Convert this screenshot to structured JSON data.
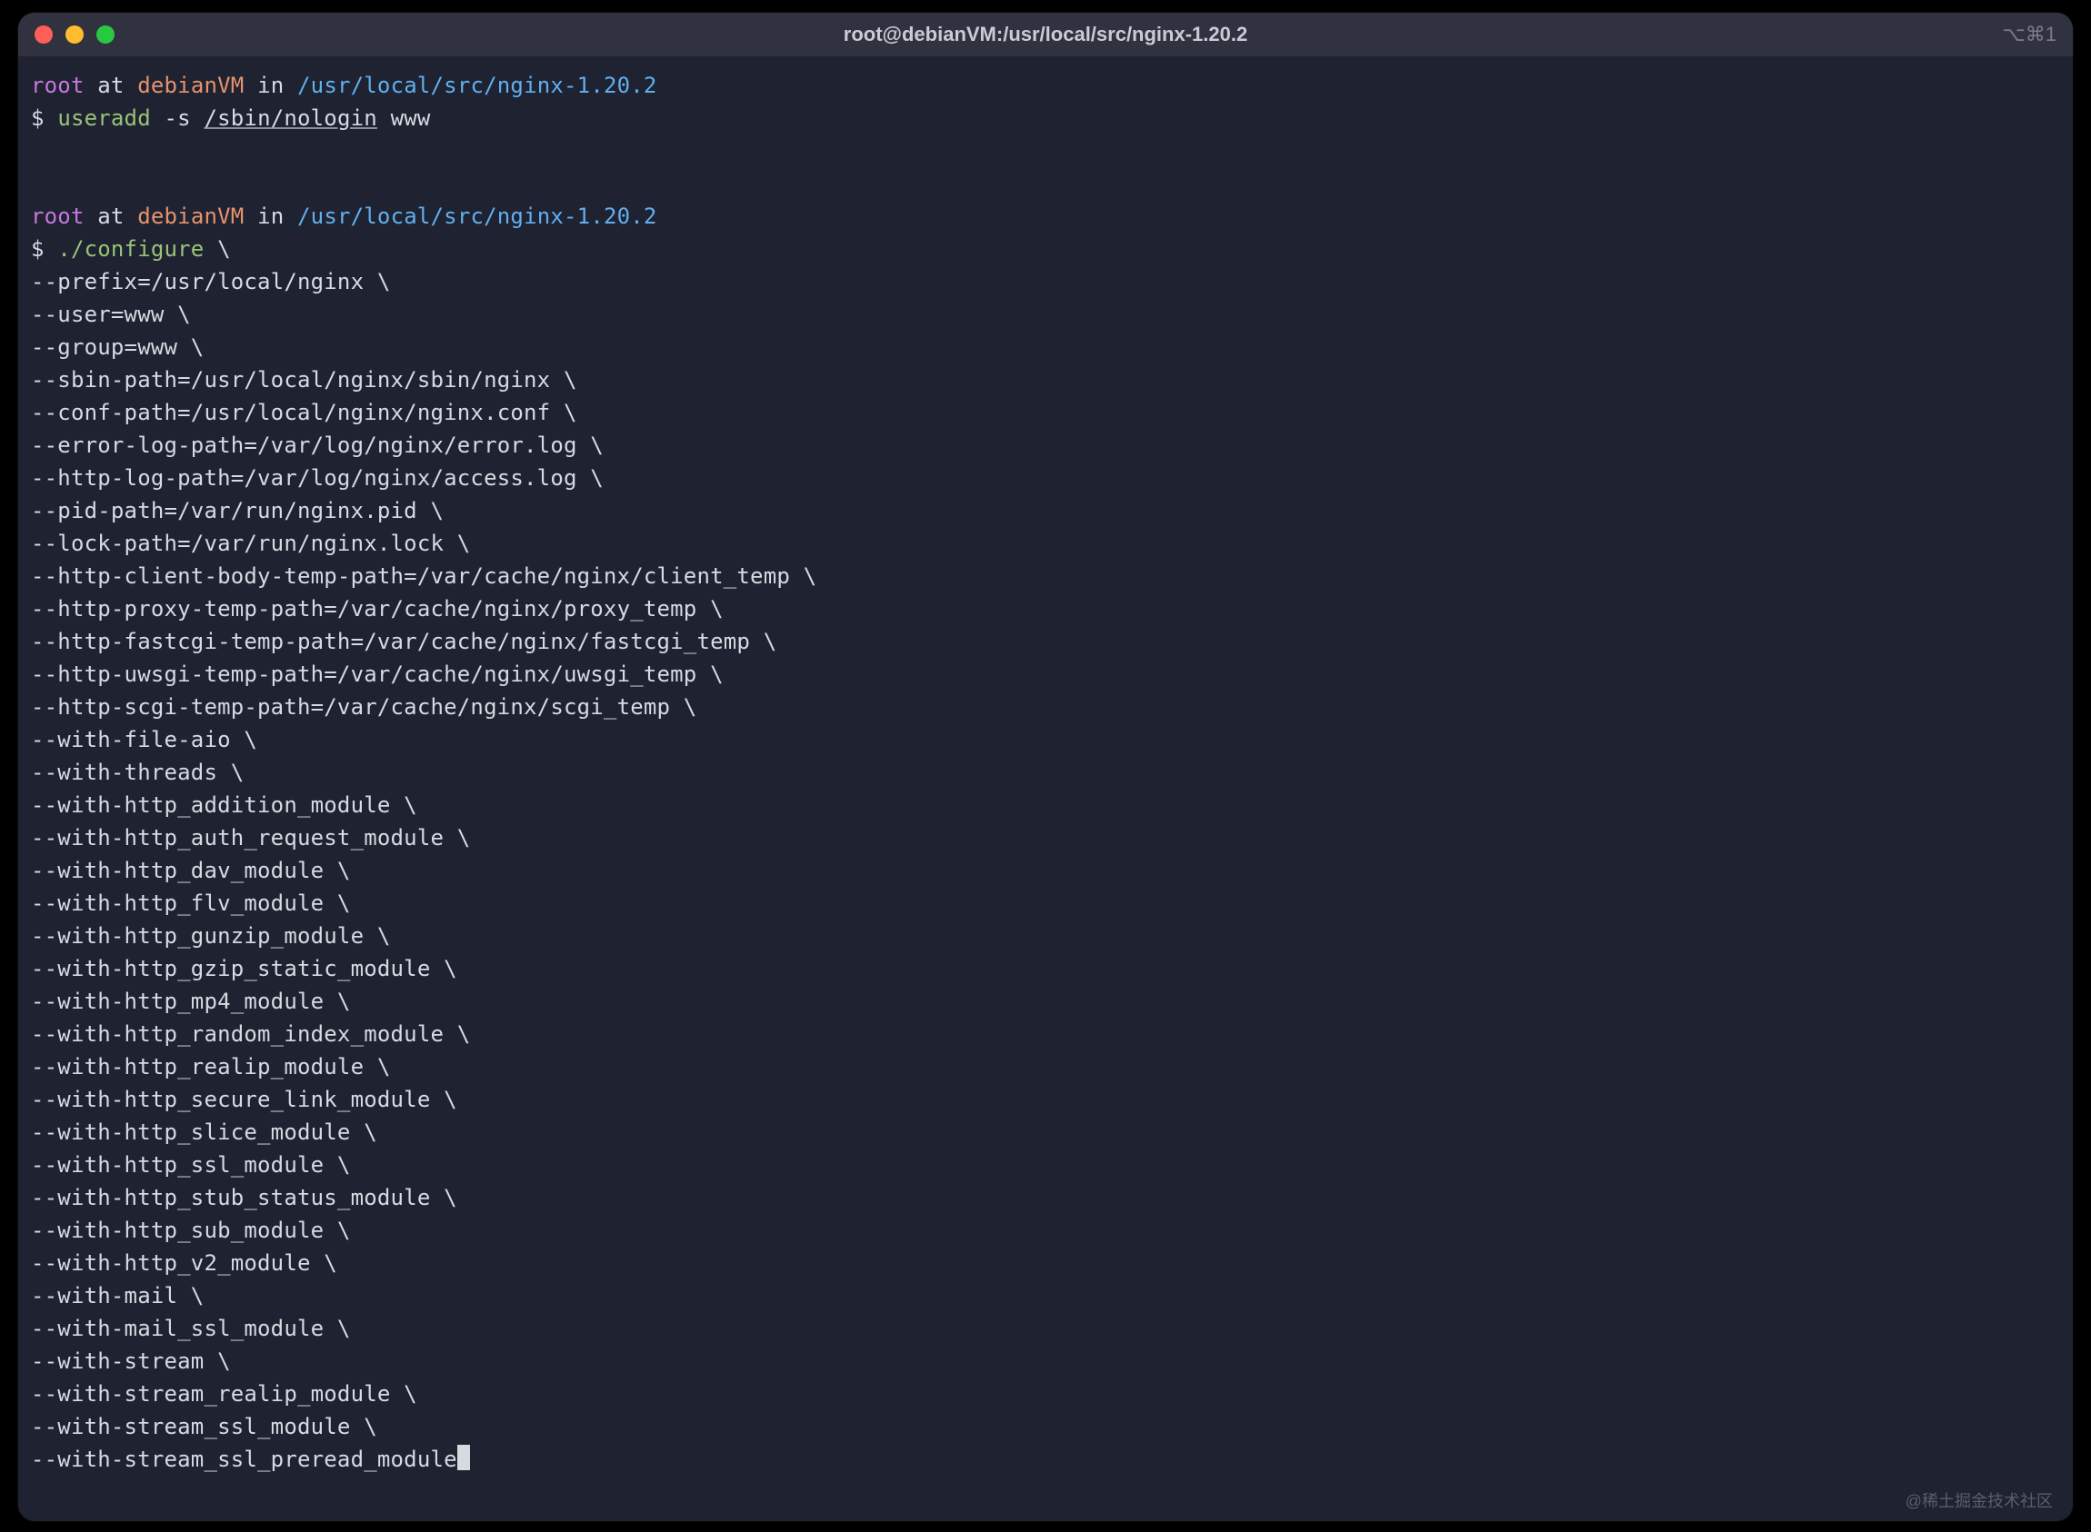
{
  "window": {
    "title": "root@debianVM:/usr/local/src/nginx-1.20.2",
    "shortcut_hint": "⌥⌘1"
  },
  "prompt1": {
    "user": "root",
    "at": " at ",
    "host": "debianVM",
    "in": " in ",
    "path": "/usr/local/src/nginx-1.20.2",
    "dollar": "$ ",
    "cmd": "useradd",
    "flag": " -s ",
    "arg_ul": "/sbin/nologin",
    "arg_rest": " www"
  },
  "prompt2": {
    "user": "root",
    "at": " at ",
    "host": "debianVM",
    "in": " in ",
    "path": "/usr/local/src/nginx-1.20.2",
    "dollar": "$ ",
    "cmd": "./configure",
    "cont": " \\"
  },
  "configure_lines": [
    "--prefix=/usr/local/nginx \\",
    "--user=www \\",
    "--group=www \\",
    "--sbin-path=/usr/local/nginx/sbin/nginx \\",
    "--conf-path=/usr/local/nginx/nginx.conf \\",
    "--error-log-path=/var/log/nginx/error.log \\",
    "--http-log-path=/var/log/nginx/access.log \\",
    "--pid-path=/var/run/nginx.pid \\",
    "--lock-path=/var/run/nginx.lock \\",
    "--http-client-body-temp-path=/var/cache/nginx/client_temp \\",
    "--http-proxy-temp-path=/var/cache/nginx/proxy_temp \\",
    "--http-fastcgi-temp-path=/var/cache/nginx/fastcgi_temp \\",
    "--http-uwsgi-temp-path=/var/cache/nginx/uwsgi_temp \\",
    "--http-scgi-temp-path=/var/cache/nginx/scgi_temp \\",
    "--with-file-aio \\",
    "--with-threads \\",
    "--with-http_addition_module \\",
    "--with-http_auth_request_module \\",
    "--with-http_dav_module \\",
    "--with-http_flv_module \\",
    "--with-http_gunzip_module \\",
    "--with-http_gzip_static_module \\",
    "--with-http_mp4_module \\",
    "--with-http_random_index_module \\",
    "--with-http_realip_module \\",
    "--with-http_secure_link_module \\",
    "--with-http_slice_module \\",
    "--with-http_ssl_module \\",
    "--with-http_stub_status_module \\",
    "--with-http_sub_module \\",
    "--with-http_v2_module \\",
    "--with-mail \\",
    "--with-mail_ssl_module \\",
    "--with-stream \\",
    "--with-stream_realip_module \\",
    "--with-stream_ssl_module \\",
    "--with-stream_ssl_preread_module"
  ],
  "watermark": "@稀土掘金技术社区"
}
